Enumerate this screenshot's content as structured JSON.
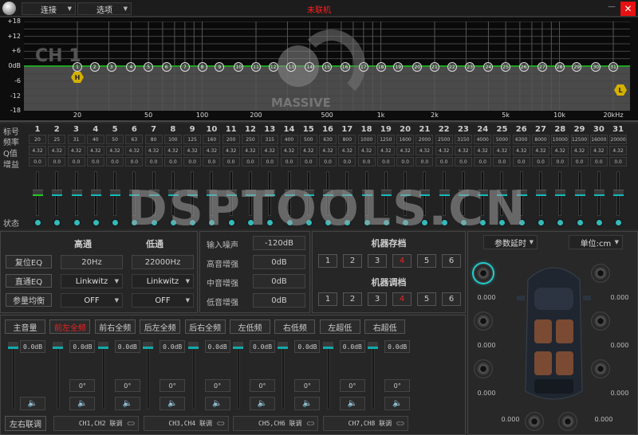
{
  "titlebar": {
    "connect": "连接",
    "options": "选项",
    "status": "未联机",
    "status_color": "#ff2020",
    "minimize": "—",
    "close": "✕"
  },
  "graph": {
    "channel_label": "CH 1",
    "logo_text": "MASSIVE",
    "y_ticks": [
      "+18",
      "+12",
      "+6",
      "0dB",
      "-6",
      "-12",
      "-18"
    ],
    "x_ticks": [
      {
        "f": 20,
        "t": "20"
      },
      {
        "f": 50,
        "t": "50"
      },
      {
        "f": 100,
        "t": "100"
      },
      {
        "f": 200,
        "t": "200"
      },
      {
        "f": 500,
        "t": "500"
      },
      {
        "f": 1000,
        "t": "1k"
      },
      {
        "f": 2000,
        "t": "2k"
      },
      {
        "f": 5000,
        "t": "5k"
      },
      {
        "f": 10000,
        "t": "10k"
      },
      {
        "f": 20000,
        "t": "20kHz"
      }
    ],
    "highpass_marker": "H",
    "lowpass_marker": "L",
    "curve_color": "#1fa31f"
  },
  "table": {
    "row_labels": {
      "number": "标号",
      "freq": "频率",
      "q": "Q值",
      "gain": "增益",
      "state": "状态"
    },
    "bands": [
      20,
      25,
      31,
      40,
      50,
      63,
      80,
      100,
      125,
      160,
      200,
      250,
      315,
      400,
      500,
      630,
      800,
      1000,
      1250,
      1600,
      2000,
      2500,
      3150,
      4000,
      5000,
      6300,
      8000,
      10000,
      12500,
      16000,
      20000
    ],
    "q": "4.32",
    "gain": "0.0"
  },
  "watermark": "DSPTOOLS.CN",
  "filters": {
    "high_title": "高通",
    "low_title": "低通",
    "reset_eq": "复位EQ",
    "bypass_eq": "直通EQ",
    "peq": "参量均衡",
    "high_freq": "20Hz",
    "low_freq": "22000Hz",
    "high_type": "Linkwitz",
    "low_type": "Linkwitz",
    "high_slope": "OFF",
    "low_slope": "OFF"
  },
  "enhance": {
    "rows": [
      {
        "label": "输入噪声",
        "value": "-120dB"
      },
      {
        "label": "高音增强",
        "value": "0dB"
      },
      {
        "label": "中音增强",
        "value": "0dB"
      },
      {
        "label": "低音增强",
        "value": "0dB"
      }
    ]
  },
  "presets": {
    "save_title": "机器存档",
    "load_title": "机器调档",
    "buttons": [
      "1",
      "2",
      "3",
      "4",
      "5",
      "6"
    ],
    "active": "4"
  },
  "mixer": {
    "channels": [
      {
        "name": "主音量",
        "active": false
      },
      {
        "name": "前左全频",
        "active": true
      },
      {
        "name": "前右全频"
      },
      {
        "name": "后左全频"
      },
      {
        "name": "后右全频"
      },
      {
        "name": "左低频"
      },
      {
        "name": "右低频"
      },
      {
        "name": "左超低"
      },
      {
        "name": "右超低"
      }
    ],
    "level": "0.0dB",
    "phase": "0°",
    "lr_link": "左右联调",
    "links": [
      "CH1,CH2 联调",
      "CH3,CH4 联调",
      "CH5,CH6 联调",
      "CH7,CH8 联调"
    ]
  },
  "delay": {
    "mode": "参数延时",
    "unit": "单位:cm",
    "values": [
      "0.000",
      "0.000",
      "0.000",
      "0.000",
      "0.000",
      "0.000",
      "0.000",
      "0.000"
    ]
  }
}
